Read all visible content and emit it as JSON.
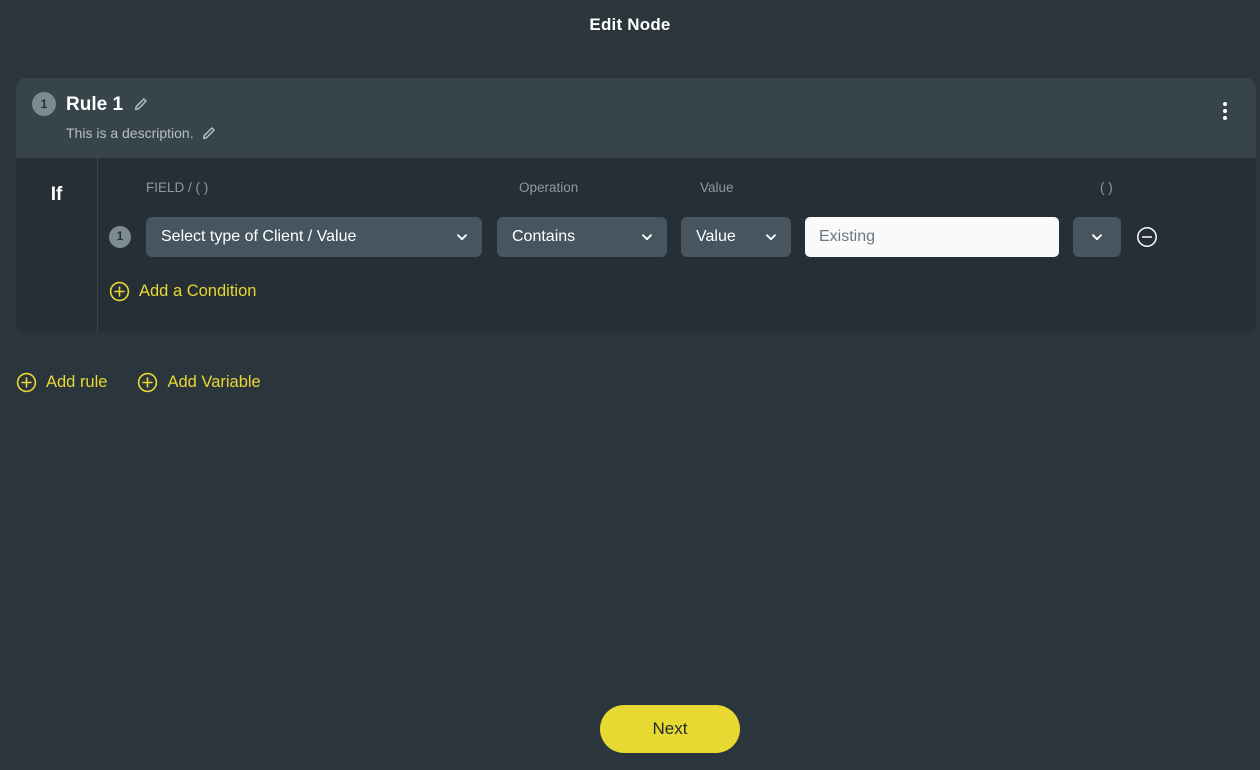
{
  "page": {
    "title": "Edit Node",
    "background_color": "#2b353c",
    "accent_color": "#e8d832"
  },
  "rule": {
    "number": "1",
    "name": "Rule 1",
    "description": "This is a description.",
    "edit_name_icon": "pencil-icon",
    "edit_description_icon": "pencil-icon",
    "menu_icon": "kebab-menu-icon",
    "if_label": "If"
  },
  "columns": {
    "field": "FIELD / ( )",
    "operation": "Operation",
    "value": "Value",
    "paren": "( )"
  },
  "condition": {
    "number": "1",
    "field": {
      "value": "Select type of Client / Value",
      "chevron_icon": "chevron-down-icon"
    },
    "operation": {
      "value": "Contains",
      "chevron_icon": "chevron-down-icon"
    },
    "value_type": {
      "value": "Value",
      "chevron_icon": "chevron-down-icon"
    },
    "value_input": {
      "value": "",
      "placeholder": "Existing"
    },
    "paren": {
      "value": "",
      "chevron_icon": "chevron-down-icon"
    },
    "remove_icon": "minus-circle-icon"
  },
  "actions": {
    "add_condition": "Add a Condition",
    "add_rule": "Add rule",
    "add_variable": "Add Variable",
    "plus_icon": "plus-circle-icon"
  },
  "footer": {
    "next": "Next"
  }
}
